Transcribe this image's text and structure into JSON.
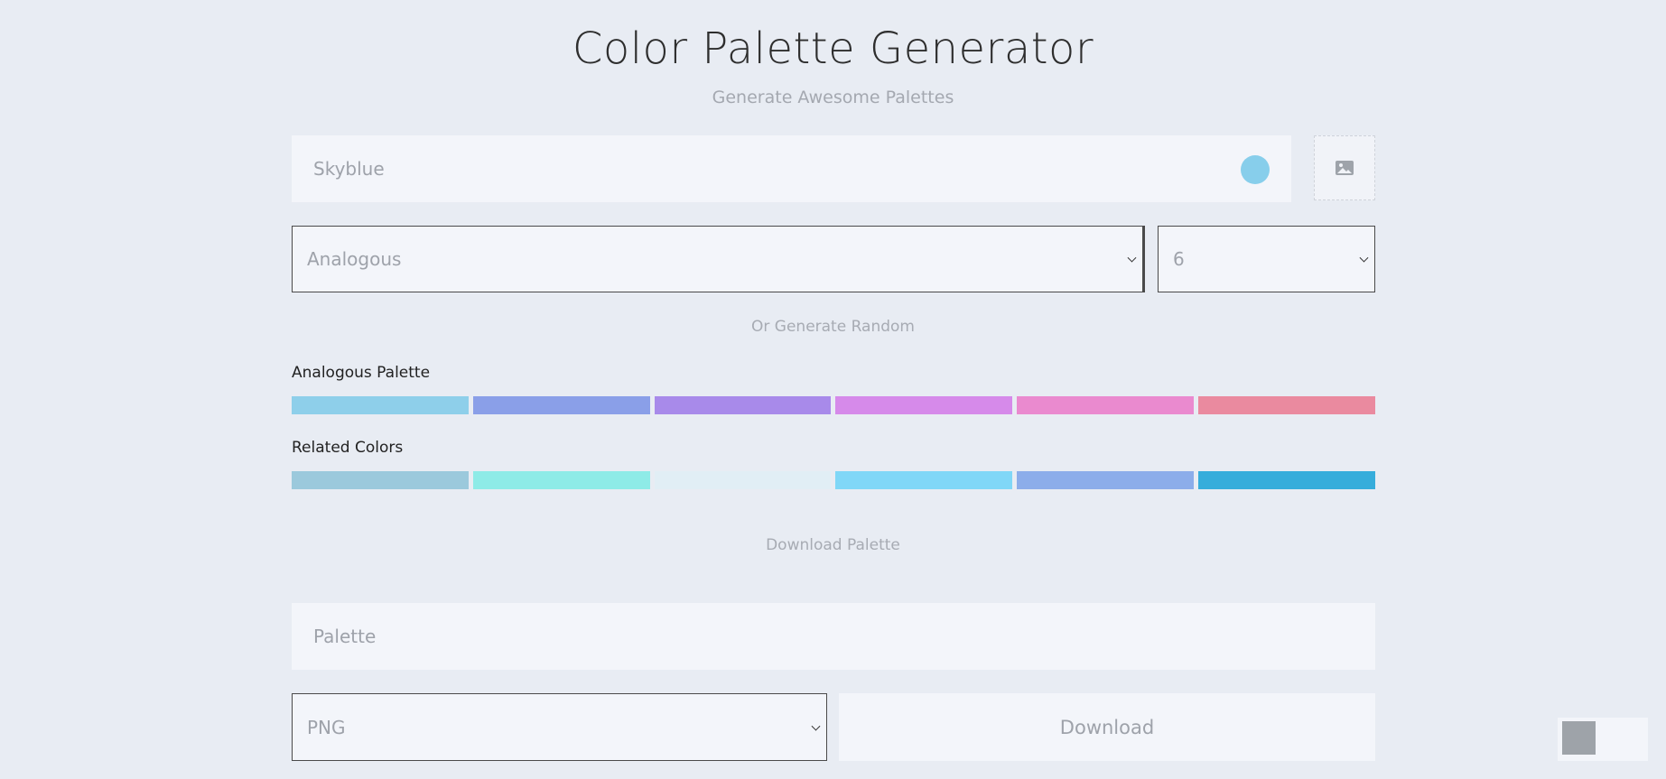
{
  "header": {
    "title": "Color Palette Generator",
    "subtitle": "Generate Awesome Palettes"
  },
  "color_input": {
    "value": "Skyblue",
    "swatch_color": "#87ceeb"
  },
  "image_button_icon": "image-icon",
  "scheme_select": {
    "selected": "Analogous"
  },
  "count_select": {
    "selected": "6"
  },
  "random_link": "Or Generate Random",
  "palette": {
    "label": "Analogous Palette",
    "colors": [
      "#8ecfea",
      "#8a9fe8",
      "#a88aea",
      "#d68aea",
      "#ea8acf",
      "#ea8a9f"
    ]
  },
  "related": {
    "label": "Related Colors",
    "colors": [
      "#9bc9dc",
      "#8eebe7",
      "#e1eef5",
      "#80d7f7",
      "#8cadea",
      "#36addb"
    ]
  },
  "download_link": "Download Palette",
  "name_input": {
    "placeholder": "Palette"
  },
  "format_select": {
    "selected": "PNG"
  },
  "download_button": "Download"
}
